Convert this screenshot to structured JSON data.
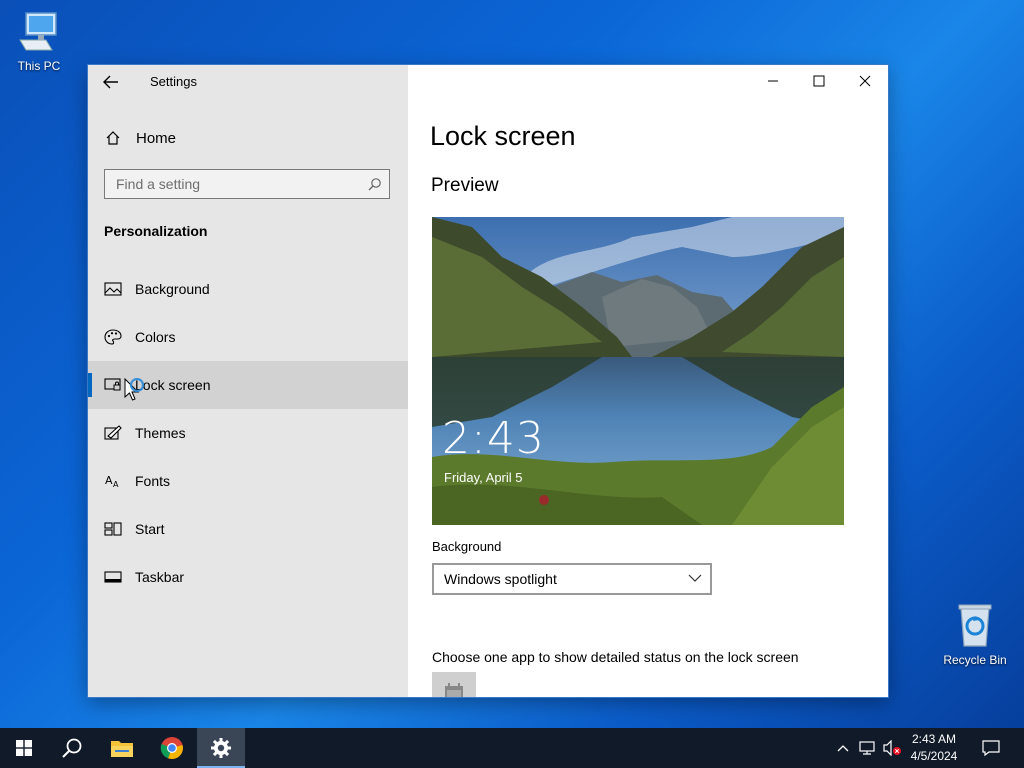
{
  "desktop": {
    "icons": [
      {
        "label": "This PC"
      },
      {
        "label": "Recycle Bin"
      }
    ]
  },
  "window": {
    "title": "Settings",
    "sidebar": {
      "home_label": "Home",
      "search_placeholder": "Find a setting",
      "section_title": "Personalization",
      "items": [
        {
          "label": "Background",
          "icon": "image-icon"
        },
        {
          "label": "Colors",
          "icon": "palette-icon"
        },
        {
          "label": "Lock screen",
          "icon": "lock-screen-icon",
          "active": true
        },
        {
          "label": "Themes",
          "icon": "themes-icon"
        },
        {
          "label": "Fonts",
          "icon": "fonts-icon"
        },
        {
          "label": "Start",
          "icon": "start-icon"
        },
        {
          "label": "Taskbar",
          "icon": "taskbar-icon"
        }
      ]
    },
    "content": {
      "title": "Lock screen",
      "preview_heading": "Preview",
      "preview_time": "2:43",
      "preview_date": "Friday, April 5",
      "background_label": "Background",
      "background_value": "Windows spotlight",
      "status_label": "Choose one app to show detailed status on the lock screen"
    }
  },
  "taskbar": {
    "clock_time": "2:43 AM",
    "clock_date": "4/5/2024",
    "pinned": [
      "start-icon",
      "search-icon",
      "file-explorer-icon",
      "chrome-icon",
      "settings-icon"
    ],
    "accent": "#0067c0"
  }
}
